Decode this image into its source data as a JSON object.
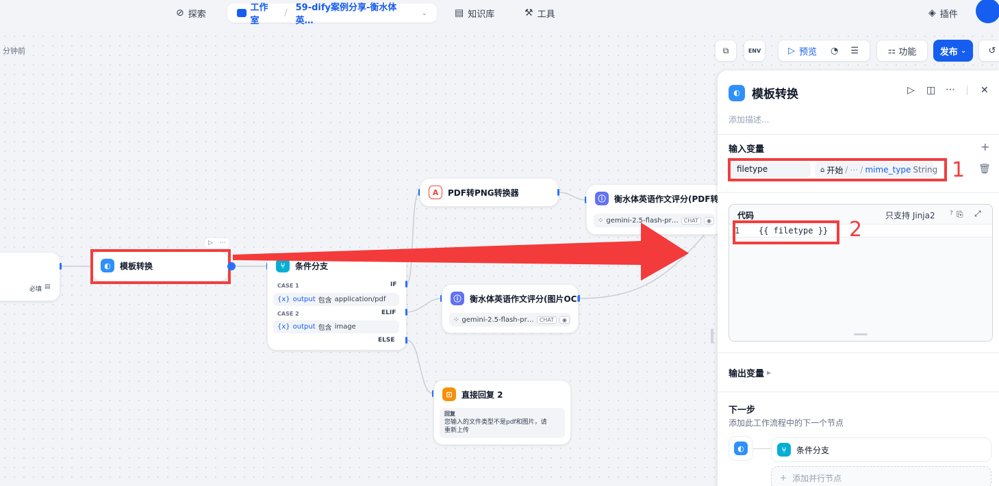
{
  "nav": {
    "explore": "探索",
    "studio": "工作室",
    "app_name": "59-dify案例分享-衡水体英…",
    "knowledge": "知识库",
    "tools": "工具",
    "plugins": "插件"
  },
  "toolbar": {
    "updated_text": "分钟前",
    "env_label": "ENV",
    "preview": "预览",
    "features": "功能",
    "publish": "发布"
  },
  "nodes": {
    "start_required": "必填",
    "template": {
      "title": "模板转换"
    },
    "ifelse": {
      "title": "条件分支",
      "case1_label": "CASE 1",
      "case1_key": "IF",
      "case1_var": "output",
      "case1_op": "包含",
      "case1_val": "application/pdf",
      "case2_label": "CASE 2",
      "case2_key": "ELIF",
      "case2_var": "output",
      "case2_op": "包含",
      "case2_val": "image",
      "else_key": "ELSE"
    },
    "pdf2png": {
      "title": "PDF转PNG转换器"
    },
    "llm_pdf": {
      "title": "衡水体英语作文评分(PDF转图片",
      "model": "gemini-2.5-flash-pr…",
      "tag": "CHAT"
    },
    "llm_ocr": {
      "title": "衡水体英语作文评分(图片OCR)",
      "model": "gemini-2.5-flash-pr…",
      "tag": "CHAT"
    },
    "answer2": {
      "title": "直接回复 2",
      "label": "回复",
      "text_line1": "您输入的文件类型不是pdf和图片，请",
      "text_line2": "重新上传"
    }
  },
  "panel": {
    "title": "模板转换",
    "description_placeholder": "添加描述...",
    "input_vars_title": "输入变量",
    "var_name": "filetype",
    "var_source_node": "开始",
    "var_source_ellipsis": "⋯",
    "var_source_name": "mime_type",
    "var_type": "String",
    "code_title": "代码",
    "jinja_hint": "只支持 Jinja2",
    "code_line_no": "1",
    "code_line": "{{ filetype }}",
    "output_vars_title": "输出变量",
    "next_step_title": "下一步",
    "next_step_desc": "添加此工作流程中的下一个节点",
    "next_node_name": "条件分支",
    "add_parallel": "添加并行节点"
  },
  "annotations": {
    "marker1": "1",
    "marker2": "2"
  },
  "colors": {
    "accent": "#155eef",
    "highlight_red": "#f03e3e",
    "arrow_red": "#f33b3b"
  }
}
